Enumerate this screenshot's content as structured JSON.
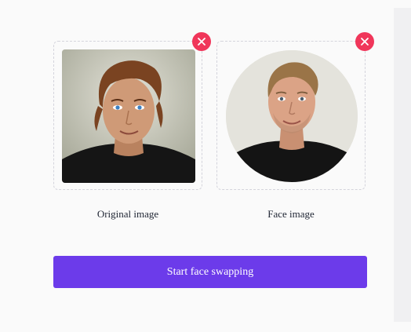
{
  "uploads": {
    "original": {
      "caption": "Original image"
    },
    "face": {
      "caption": "Face image"
    }
  },
  "actions": {
    "start_label": "Start face swapping"
  },
  "colors": {
    "accent": "#6c3bea",
    "remove": "#f0365a",
    "text": "#1f2533"
  }
}
